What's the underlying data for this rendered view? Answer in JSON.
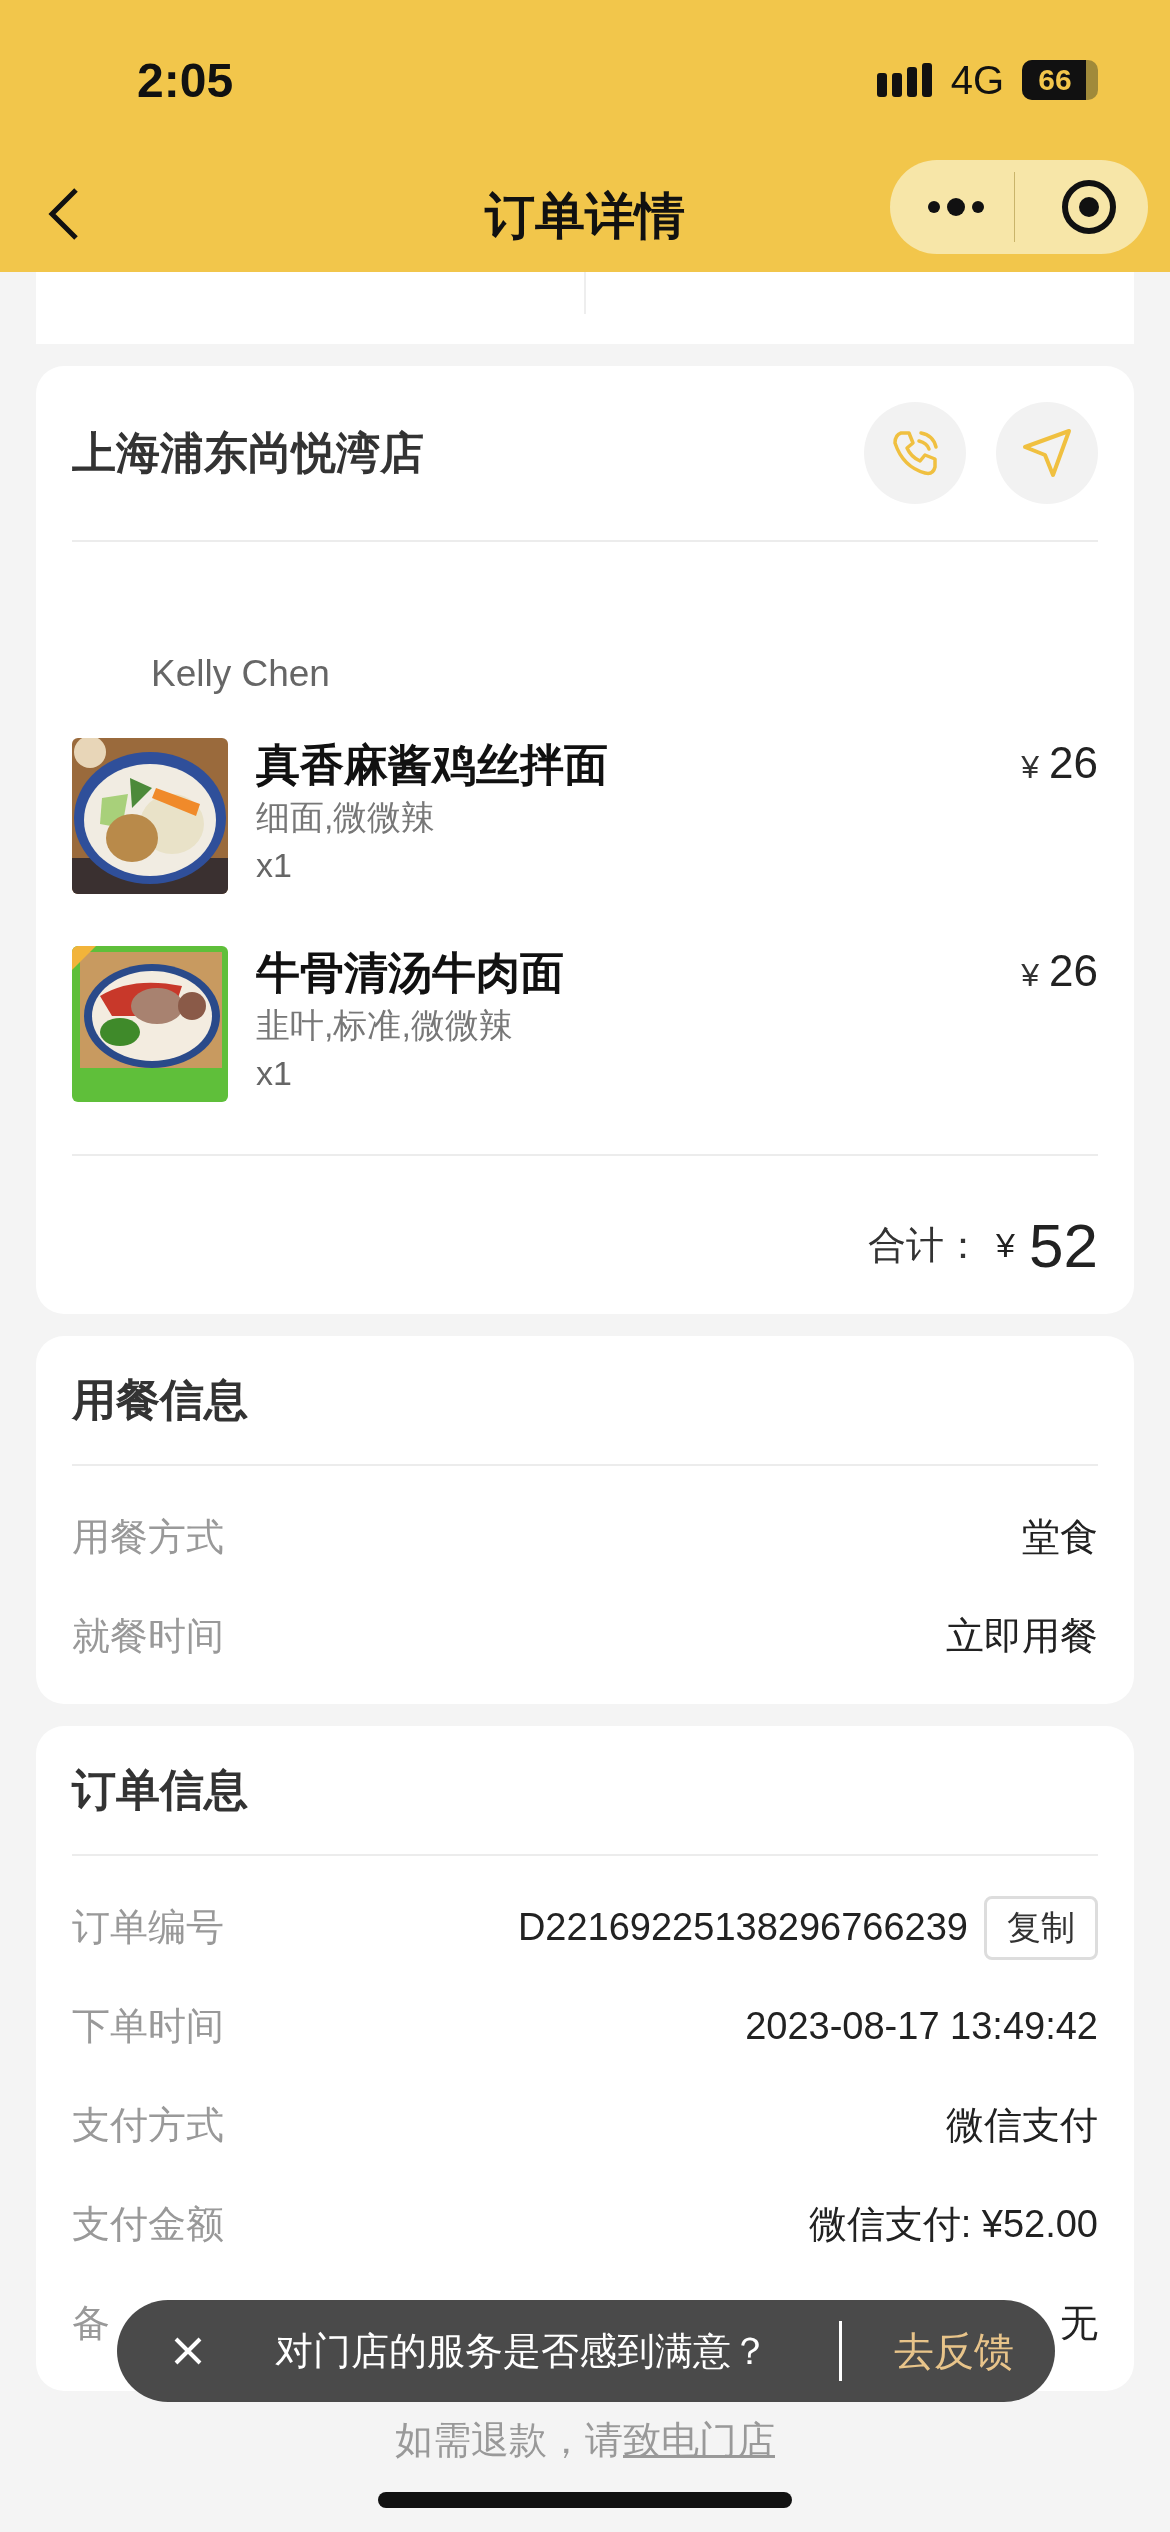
{
  "status_bar": {
    "time": "2:05",
    "network": "4G",
    "battery": "66"
  },
  "nav": {
    "title": "订单详情"
  },
  "store": {
    "name": "上海浦东尚悦湾店",
    "customer": "Kelly Chen",
    "items": [
      {
        "name": "真香麻酱鸡丝拌面",
        "options": "细面,微微辣",
        "quantity": "x1",
        "currency": "¥",
        "price": "26",
        "kind": "picture"
      },
      {
        "name": "牛骨清汤牛肉面",
        "options": "韭叶,标准,微微辣",
        "quantity": "x1",
        "currency": "¥",
        "price": "26",
        "kind": "picture"
      }
    ],
    "total_label": "合计：",
    "total_currency": "¥",
    "total": "52"
  },
  "dining_info": {
    "title": "用餐信息",
    "rows": [
      {
        "label": "用餐方式",
        "value": "堂食"
      },
      {
        "label": "就餐时间",
        "value": "立即用餐"
      }
    ]
  },
  "order_info": {
    "title": "订单信息",
    "rows": [
      {
        "label": "订单编号",
        "value": "D22169225138296766239",
        "action": "复制"
      },
      {
        "label": "下单时间",
        "value": "2023-08-17 13:49:42"
      },
      {
        "label": "支付方式",
        "value": "微信支付"
      },
      {
        "label": "支付金额",
        "value": "微信支付: ¥52.00"
      },
      {
        "label": "备",
        "value": "无"
      }
    ]
  },
  "toast": {
    "message": "对门店的服务是否感到满意？",
    "action": "去反馈"
  },
  "footer": {
    "text": "如需退款，请",
    "link": "致电门店"
  }
}
